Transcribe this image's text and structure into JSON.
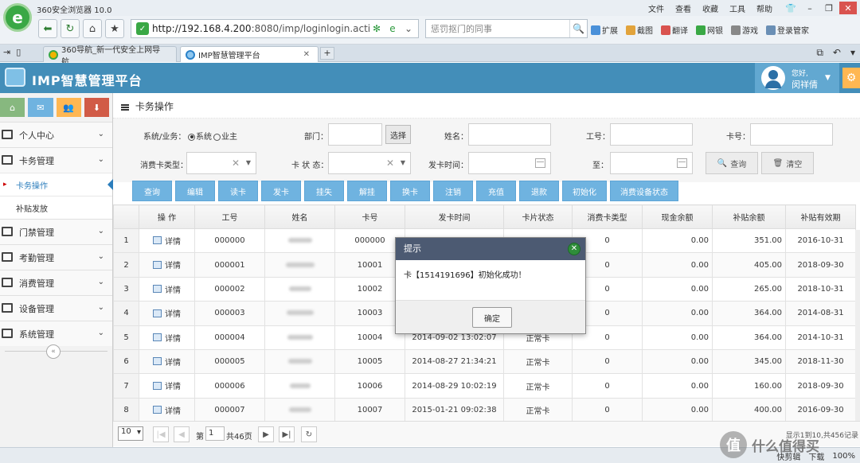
{
  "browser": {
    "app_title": "360安全浏览器 10.0",
    "menus": [
      "文件",
      "查看",
      "收藏",
      "工具",
      "帮助"
    ],
    "url_host": "http://192.168.4.200",
    "url_path": ":8080/imp/loginlogin.action;jses",
    "search_placeholder": "惩罚抠门的同事",
    "plugins": [
      "扩展",
      "截图",
      "翻译",
      "网银",
      "游戏",
      "登录管家"
    ],
    "tabs": [
      {
        "title": "360导航_新一代安全上网导航",
        "active": false
      },
      {
        "title": "IMP智慧管理平台",
        "active": true
      }
    ]
  },
  "app": {
    "title": "IMP智慧管理平台",
    "greeting": "您好,",
    "username": "闵祥倩"
  },
  "sidebar": {
    "shortcut_colors": [
      "#87b87f",
      "#6fb3e0",
      "#ffb752",
      "#d15b47"
    ],
    "items": [
      {
        "label": "个人中心",
        "open": false
      },
      {
        "label": "卡务管理",
        "open": true,
        "children": [
          {
            "label": "卡务操作",
            "active": true
          },
          {
            "label": "补贴发放",
            "active": false
          }
        ]
      },
      {
        "label": "门禁管理",
        "open": false
      },
      {
        "label": "考勤管理",
        "open": false
      },
      {
        "label": "消费管理",
        "open": false
      },
      {
        "label": "设备管理",
        "open": false
      },
      {
        "label": "系统管理",
        "open": false
      }
    ]
  },
  "page": {
    "title": "卡务操作",
    "filters": {
      "biz_label": "系统/业务：",
      "opt_system": "系统",
      "opt_owner": "业主",
      "dept_label": "部门：",
      "select_btn": "选择",
      "name_label": "姓名：",
      "empno_label": "工号：",
      "cardno_label": "卡号：",
      "cardtype_label": "消费卡类型：",
      "cardstatus_label": "卡 状 态：",
      "issuetime_label": "发卡时间：",
      "to_label": "至：",
      "query_btn": "查询",
      "clear_btn": "清空"
    },
    "actions": [
      "查询",
      "编辑",
      "读卡",
      "发卡",
      "挂失",
      "解挂",
      "换卡",
      "注销",
      "充值",
      "退款",
      "初始化",
      "消费设备状态"
    ],
    "table": {
      "columns": [
        "",
        "操 作",
        "工号",
        "姓名",
        "卡号",
        "发卡时间",
        "卡片状态",
        "消费卡类型",
        "现金余额",
        "补贴余额",
        "补贴有效期"
      ],
      "detail_label": "详情",
      "rows": [
        {
          "no": "1",
          "emp": "000000",
          "card": "000000",
          "time": "",
          "status": "",
          "type": "0",
          "cash": "0.00",
          "subsidy": "351.00",
          "expire": "2016-10-31"
        },
        {
          "no": "2",
          "emp": "000001",
          "card": "10001",
          "time": "",
          "status": "",
          "type": "0",
          "cash": "0.00",
          "subsidy": "405.00",
          "expire": "2018-09-30"
        },
        {
          "no": "3",
          "emp": "000002",
          "card": "10002",
          "time": "",
          "status": "",
          "type": "0",
          "cash": "0.00",
          "subsidy": "265.00",
          "expire": "2018-10-31"
        },
        {
          "no": "4",
          "emp": "000003",
          "card": "10003",
          "time": "",
          "status": "",
          "type": "0",
          "cash": "0.00",
          "subsidy": "364.00",
          "expire": "2014-08-31"
        },
        {
          "no": "5",
          "emp": "000004",
          "card": "10004",
          "time": "2014-09-02 13:02:07",
          "status": "正常卡",
          "type": "0",
          "cash": "0.00",
          "subsidy": "364.00",
          "expire": "2014-10-31"
        },
        {
          "no": "6",
          "emp": "000005",
          "card": "10005",
          "time": "2014-08-27 21:34:21",
          "status": "正常卡",
          "type": "0",
          "cash": "0.00",
          "subsidy": "345.00",
          "expire": "2018-11-30"
        },
        {
          "no": "7",
          "emp": "000006",
          "card": "10006",
          "time": "2014-08-29 10:02:19",
          "status": "正常卡",
          "type": "0",
          "cash": "0.00",
          "subsidy": "160.00",
          "expire": "2018-09-30"
        },
        {
          "no": "8",
          "emp": "000007",
          "card": "10007",
          "time": "2015-01-21 09:02:38",
          "status": "正常卡",
          "type": "0",
          "cash": "0.00",
          "subsidy": "400.00",
          "expire": "2016-09-30"
        }
      ]
    },
    "pager": {
      "page_size": "10",
      "page_prefix": "第",
      "current_page": "1",
      "page_suffix": "共46页",
      "record_info": "显示1到10,共456记录"
    }
  },
  "dialog": {
    "title": "提示",
    "message": "卡【1514191696】初始化成功！",
    "ok_label": "确定"
  },
  "statusbar": {
    "items": [
      "快剪辑",
      "下载",
      "100%"
    ]
  },
  "watermark": {
    "icon_char": "值",
    "text": "什么值得买"
  }
}
